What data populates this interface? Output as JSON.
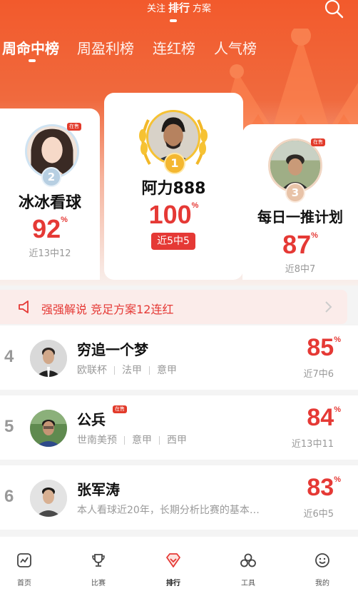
{
  "topnav": {
    "follow": "关注",
    "rank": "排行",
    "plans": "方案"
  },
  "tabs": [
    {
      "label": "周命中榜"
    },
    {
      "label": "周盈利榜"
    },
    {
      "label": "连红榜"
    },
    {
      "label": "人气榜"
    }
  ],
  "podium": {
    "first": {
      "medal": "1",
      "name": "阿力888",
      "rate": "100",
      "rate_unit": "%",
      "record": "近5中5"
    },
    "second": {
      "medal": "2",
      "name": "冰冰看球",
      "rate": "92",
      "rate_unit": "%",
      "record": "近13中12",
      "tag": "在售"
    },
    "third": {
      "medal": "3",
      "name": "每日一推计划",
      "rate": "87",
      "rate_unit": "%",
      "record": "近8中7",
      "tag": "在售"
    }
  },
  "notice": {
    "text": "强强解说 竞足方案12连红"
  },
  "list": [
    {
      "rank": "4",
      "name": "穷追一个梦",
      "tags": [
        "欧联杯",
        "法甲",
        "意甲"
      ],
      "rate": "85",
      "rate_unit": "%",
      "record": "近7中6"
    },
    {
      "rank": "5",
      "name": "公兵",
      "badge": "在售",
      "tags": [
        "世南美预",
        "意甲",
        "西甲"
      ],
      "rate": "84",
      "rate_unit": "%",
      "record": "近13中11"
    },
    {
      "rank": "6",
      "name": "张军涛",
      "desc": "本人看球近20年，长期分析比赛的基本…",
      "rate": "83",
      "rate_unit": "%",
      "record": "近6中5"
    }
  ],
  "bottom_nav": [
    {
      "label": "首页",
      "icon": "home-chart-icon"
    },
    {
      "label": "比赛",
      "icon": "trophy-icon"
    },
    {
      "label": "排行",
      "icon": "rank-gem-icon"
    },
    {
      "label": "工具",
      "icon": "tools-icon"
    },
    {
      "label": "我的",
      "icon": "smile-icon"
    }
  ],
  "colors": {
    "accent": "#e53935",
    "header": "#f25a2c",
    "gold": "#f6c233"
  }
}
